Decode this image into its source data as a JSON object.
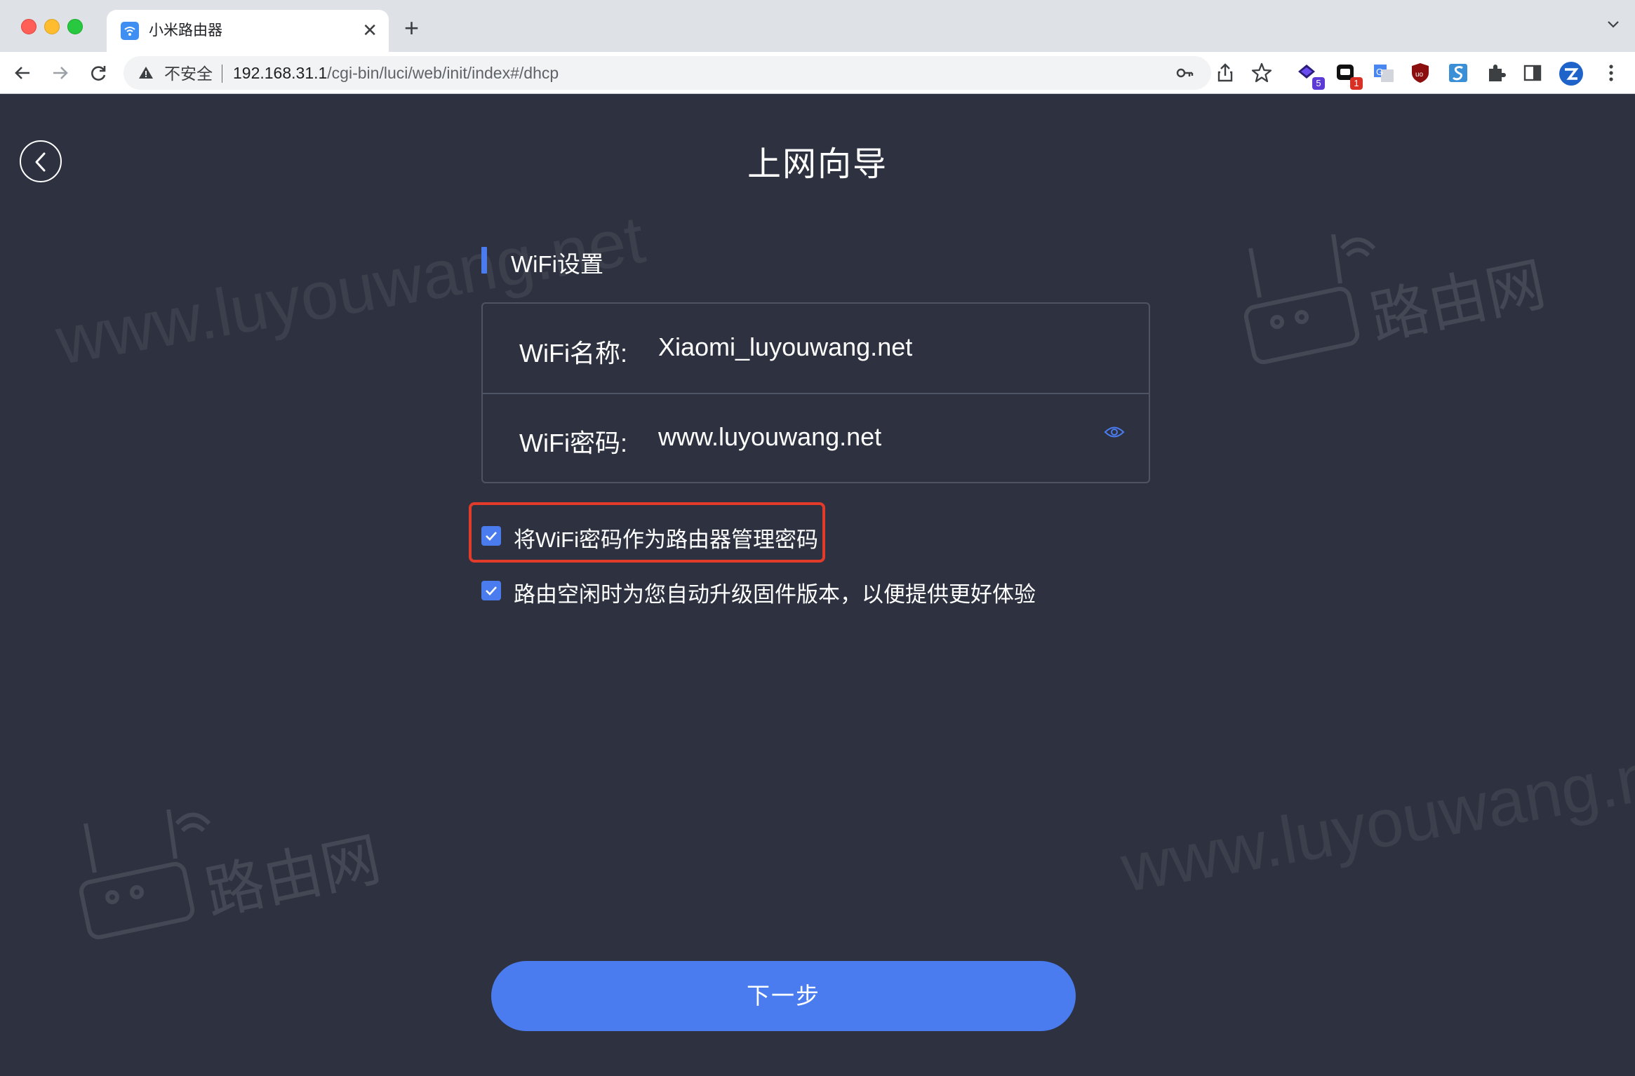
{
  "browser": {
    "tab": {
      "title": "小米路由器"
    },
    "new_tab_label": "+",
    "tab_close_label": "✕",
    "address": {
      "security_label": "不安全",
      "url_host": "192.168.31.1",
      "url_path": "/cgi-bin/luci/web/init/index#/dhcp"
    },
    "extensions": [
      {
        "name": "ext-1",
        "badge": "5",
        "badge_color": "#5b3ad6"
      },
      {
        "name": "ext-2",
        "badge": "1",
        "badge_color": "#d93025"
      }
    ]
  },
  "page": {
    "title": "上网向导",
    "section_title": "WiFi设置",
    "wifi_name": {
      "label": "WiFi名称:",
      "value": "Xiaomi_luyouwang.net"
    },
    "wifi_password": {
      "label": "WiFi密码:",
      "value": "www.luyouwang.net"
    },
    "options": [
      {
        "label": "将WiFi密码作为路由器管理密码",
        "checked": true,
        "highlighted": true
      },
      {
        "label": "路由空闲时为您自动升级固件版本，以便提供更好体验",
        "checked": true,
        "highlighted": false
      }
    ],
    "next_button": "下一步"
  },
  "watermarks": {
    "text": "www.luyouwang.net",
    "logo_text": "路由网"
  },
  "colors": {
    "background": "#2e3240",
    "accent": "#4a7cf0",
    "highlight_border": "#e33b2a"
  }
}
